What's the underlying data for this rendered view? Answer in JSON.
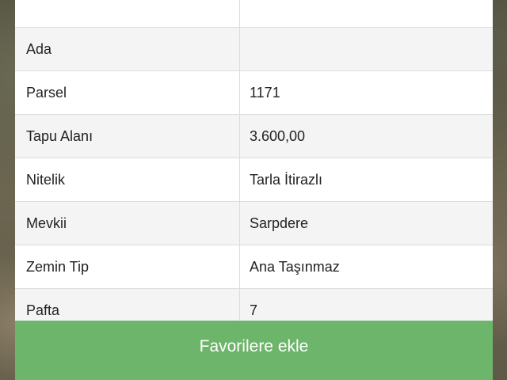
{
  "details": {
    "rows": [
      {
        "label": "",
        "value": ""
      },
      {
        "label": "Ada",
        "value": ""
      },
      {
        "label": "Parsel",
        "value": "1171"
      },
      {
        "label": "Tapu Alanı",
        "value": "3.600,00"
      },
      {
        "label": "Nitelik",
        "value": "Tarla İtirazlı"
      },
      {
        "label": "Mevkii",
        "value": "Sarpdere"
      },
      {
        "label": "Zemin Tip",
        "value": "Ana Taşınmaz"
      },
      {
        "label": "Pafta",
        "value": "7"
      }
    ]
  },
  "actions": {
    "favorite_label": "Favorilere ekle"
  },
  "colors": {
    "button_green": "#6db56a",
    "row_alt": "#f4f4f4"
  }
}
